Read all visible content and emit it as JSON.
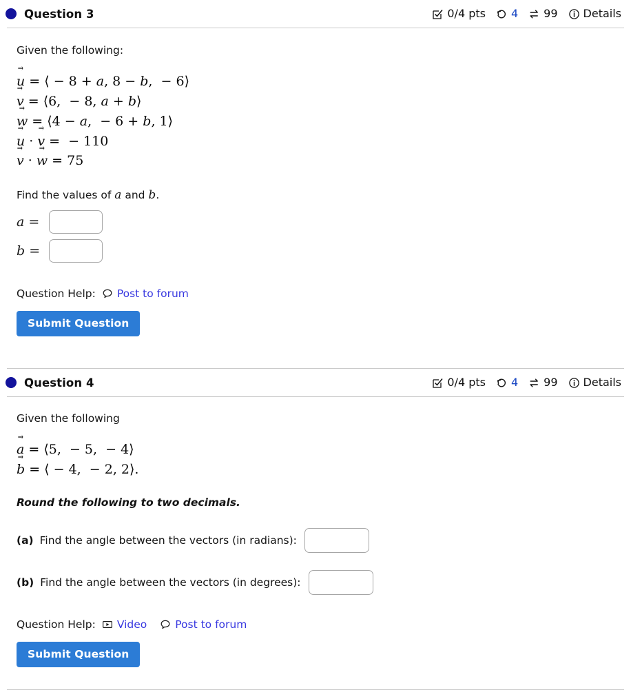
{
  "questions": [
    {
      "dot_color": "#13139c",
      "title": "Question 3",
      "meta": {
        "score_icon": "checkbox-check-icon",
        "score": "0/4 pts",
        "attempts_icon": "undo-circle-arrow-icon",
        "attempts": "4",
        "versions_icon": "swap-arrows-icon",
        "versions": "99",
        "details_icon": "info-circle-icon",
        "details": "Details"
      },
      "prompt": "Given the following:",
      "math_lines": [
        "u = ⟨ − 8 + a, 8 − b, − 6⟩",
        "v = ⟨6, − 8, a + b⟩",
        "w = ⟨4 − a, − 6 + b, 1⟩",
        "u · v = − 110",
        "v · w = 75"
      ],
      "instruction_prefix": "Find the values of ",
      "instruction_var1": "a",
      "instruction_middle": " and ",
      "instruction_var2": "b",
      "instruction_suffix": ".",
      "answers": [
        {
          "label": "a =",
          "value": "",
          "placeholder": ""
        },
        {
          "label": "b =",
          "value": "",
          "placeholder": ""
        }
      ],
      "help_label": "Question Help:",
      "help_links": [
        {
          "icon": "speech-bubble-icon",
          "label": "Post to forum"
        }
      ],
      "submit_label": "Submit Question"
    },
    {
      "dot_color": "#13139c",
      "title": "Question 4",
      "meta": {
        "score_icon": "checkbox-check-icon",
        "score": "0/4 pts",
        "attempts_icon": "undo-circle-arrow-icon",
        "attempts": "4",
        "versions_icon": "swap-arrows-icon",
        "versions": "99",
        "details_icon": "info-circle-icon",
        "details": "Details"
      },
      "prompt": "Given the following",
      "math_lines": [
        "a = ⟨5, − 5, − 4⟩",
        "b = ⟨ − 4, − 2, 2⟩."
      ],
      "note": "Round the following to two decimals.",
      "parts": [
        {
          "tag": "(a)",
          "text": "Find the angle between the vectors (in radians):",
          "value": "",
          "placeholder": ""
        },
        {
          "tag": "(b)",
          "text": "Find the angle between the vectors (in degrees):",
          "value": "",
          "placeholder": ""
        }
      ],
      "help_label": "Question Help:",
      "help_links": [
        {
          "icon": "video-play-icon",
          "label": "Video"
        },
        {
          "icon": "speech-bubble-icon",
          "label": "Post to forum"
        }
      ],
      "submit_label": "Submit Question"
    }
  ],
  "colors": {
    "accent_blue": "#2c7cd6",
    "link_blue": "#3838e0",
    "dot_navy": "#13139c",
    "divider_gray": "#c9c9c9"
  }
}
